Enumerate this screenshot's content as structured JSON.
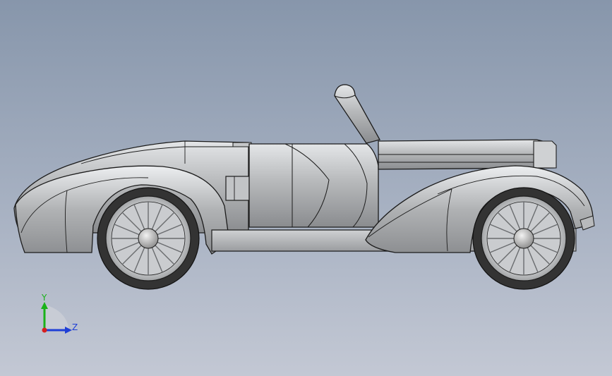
{
  "viewport": {
    "background_top": "#8796ab",
    "background_bottom": "#c3c8d4"
  },
  "model": {
    "body_color": "#b4b6b8",
    "body_highlight": "#e2e4e6",
    "body_shadow": "#7e8083",
    "outline_color": "#1c1c1c",
    "tire_color": "#3a3a3a",
    "hub_color": "#c8c8c8"
  },
  "triad": {
    "y_label": "Y",
    "z_label": "Z",
    "y_color": "#19b219",
    "z_color": "#1f3fd6",
    "x_color": "#d61f1f"
  }
}
